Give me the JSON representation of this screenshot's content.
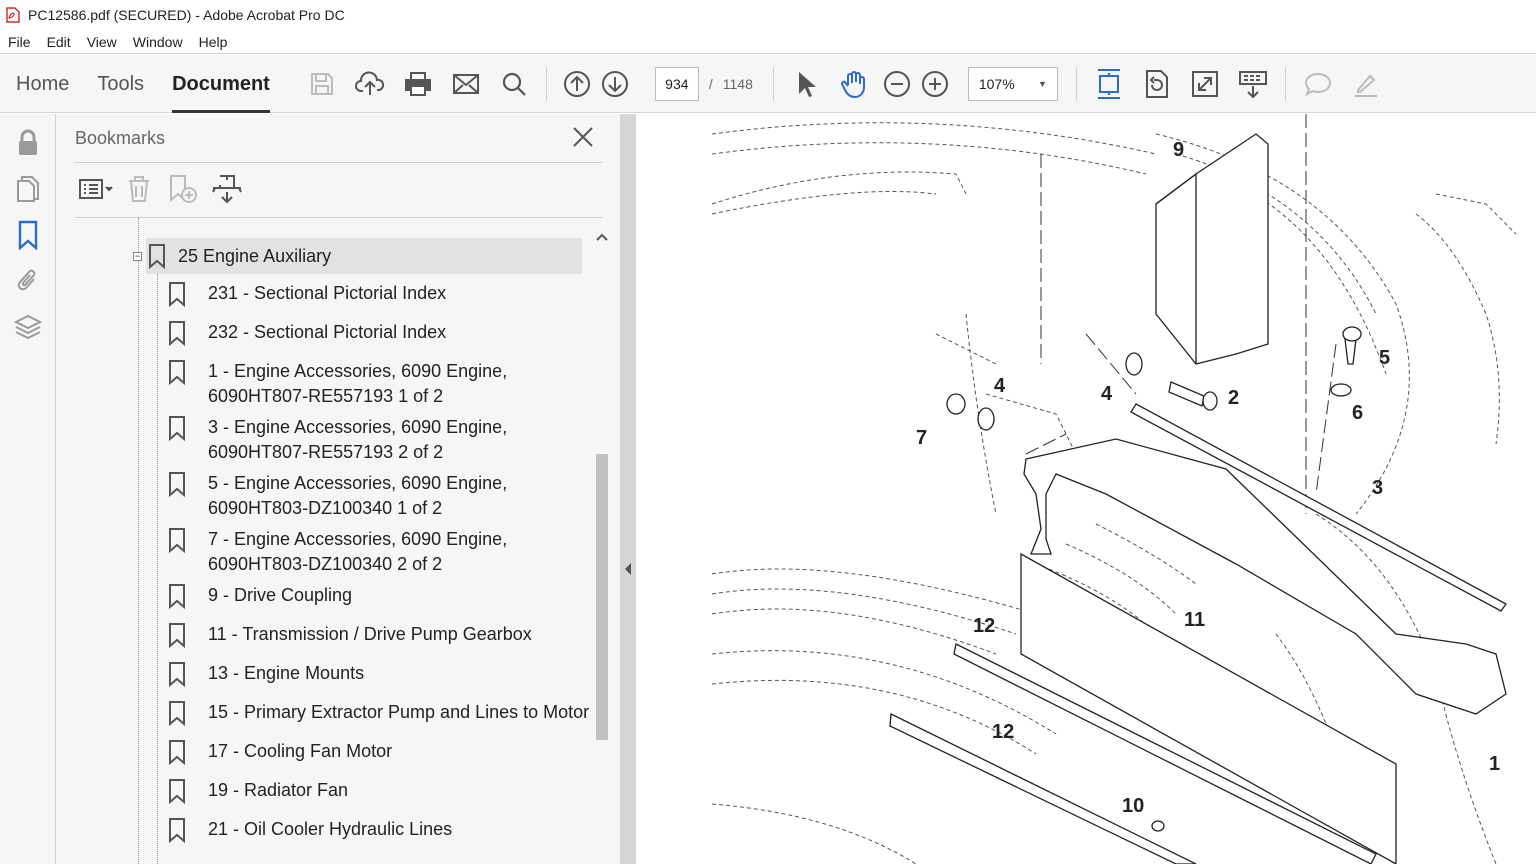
{
  "window": {
    "title": "PC12586.pdf (SECURED) - Adobe Acrobat Pro DC"
  },
  "menu": [
    "File",
    "Edit",
    "View",
    "Window",
    "Help"
  ],
  "tabs": {
    "home": "Home",
    "tools": "Tools",
    "document": "Document"
  },
  "toolbar": {
    "page_current": "934",
    "page_sep": "/",
    "page_total": "1148",
    "zoom": "107%"
  },
  "bookmarks": {
    "title": "Bookmarks",
    "parent": "25 Engine Auxiliary",
    "items": [
      [
        "231 - Sectional Pictorial Index"
      ],
      [
        "232 - Sectional Pictorial Index"
      ],
      [
        "1 - Engine Accessories, 6090 Engine,",
        "6090HT807-RE557193 1 of 2"
      ],
      [
        "3 - Engine Accessories, 6090 Engine,",
        "6090HT807-RE557193 2 of 2"
      ],
      [
        "5 - Engine Accessories, 6090 Engine,",
        "6090HT803-DZ100340 1 of 2"
      ],
      [
        "7 - Engine Accessories, 6090 Engine,",
        "6090HT803-DZ100340 2 of 2"
      ],
      [
        "9 - Drive Coupling"
      ],
      [
        "11 - Transmission / Drive Pump Gearbox"
      ],
      [
        "13 - Engine Mounts"
      ],
      [
        "15 - Primary Extractor Pump and Lines to Motor"
      ],
      [
        "17 - Cooling Fan Motor"
      ],
      [
        "19 - Radiator Fan"
      ],
      [
        "21 - Oil Cooler Hydraulic Lines"
      ]
    ]
  },
  "callouts": [
    "9",
    "2",
    "4",
    "4",
    "5",
    "6",
    "7",
    "3",
    "12",
    "11",
    "12",
    "1",
    "10"
  ],
  "colors": {
    "accent_blue": "#2b6cc4",
    "toolbar_bg": "#f6f6f6",
    "selected_bg": "#e2e2e2"
  }
}
